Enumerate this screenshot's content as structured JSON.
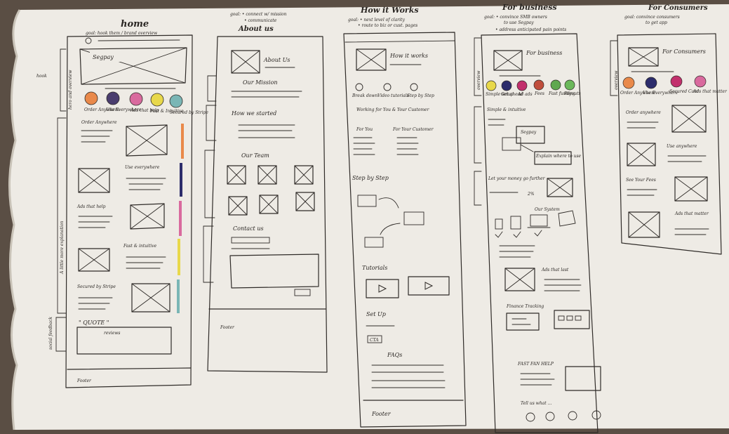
{
  "columns": [
    {
      "id": "home",
      "title": "home",
      "goal": "goal: hook them / brand overview"
    },
    {
      "id": "about",
      "title": "About us",
      "goal": "goal: • connect w/ mission",
      "goal2": "• communicate"
    },
    {
      "id": "how",
      "title": "How it Works",
      "goal": "goal: • next level of clarity",
      "goal2": "• route to biz or cust. pages"
    },
    {
      "id": "business",
      "title": "For business",
      "goal": "goal: • convince SMB owners",
      "goal2": "to use Segpay",
      "goal3": "• address anticipated pain points"
    },
    {
      "id": "consumers",
      "title": "For Consumers",
      "goal": "goal: convince consumers",
      "goal2": "to get app"
    }
  ],
  "home": {
    "side_hook": "hook",
    "side_hero": "hero and overview",
    "side_more": "A little more explanation",
    "side_social": "social feedback",
    "logo": "Segpay",
    "circles": [
      "Order Anywhere",
      "Use Everywhere",
      "Ads that help",
      "Fast & Intuitive",
      "Secured by Stripe"
    ],
    "section1": "Order Anywhere",
    "section2": "Use everywhere",
    "section3": "Ads that help",
    "section4": "Fast & intuitive",
    "section5": "Secured by Stripe",
    "quote": "\" QUOTE \"",
    "reviews": "reviews",
    "footer": "Footer"
  },
  "about": {
    "hero": "About Us",
    "mission": "Our Mission",
    "started": "How we started",
    "team": "Our Team",
    "contact": "Contact us",
    "footer": "Footer"
  },
  "how": {
    "hero": "How it works",
    "steps": [
      "Break down",
      "Video tutorials",
      "Step by Step"
    ],
    "working": "Working for You & Your Customer",
    "for_you": "For You",
    "for_customer": "For Your Customer",
    "step": "Step by Step",
    "tutorials": "Tutorials",
    "setup": "Set Up",
    "cta": "CTA",
    "faqs": "FAQs",
    "footer": "Footer"
  },
  "business": {
    "side_hero": "overview",
    "hero": "For business",
    "circles": [
      "Simple setup",
      "Get ahead",
      "Ad ads",
      "Fees",
      "Fast funding",
      "Payouts"
    ],
    "simple": "Simple & intuitive",
    "logo": "Segpay",
    "explain": "Explain where to use",
    "money": "Let your money go further",
    "percent": "2%",
    "system": "Our System",
    "ads": "Ads that last",
    "finance": "Finance Tracking",
    "fast": "FAST FAN HELP",
    "tell": "Tell us what ..."
  },
  "consumers": {
    "side_hero": "overview",
    "hero": "For Consumers",
    "circles": [
      "Order Anywhere",
      "Use Everywhere",
      "Secured Card",
      "Ads that matter"
    ],
    "order": "Order anywhere",
    "use": "Use anywhere",
    "see": "See Your Fees",
    "ads": "Ads that matter"
  },
  "colors": {
    "paper": "#efece6",
    "ink": "#2f2b28",
    "orange": "#e9894a",
    "purple": "#4a3d6e",
    "pink": "#d96a9e",
    "yellow": "#e8d84a",
    "teal": "#7ab6b5",
    "green": "#5fa84f",
    "magenta": "#c2306c",
    "navy": "#2c2c6b",
    "rust": "#c04e3c"
  }
}
